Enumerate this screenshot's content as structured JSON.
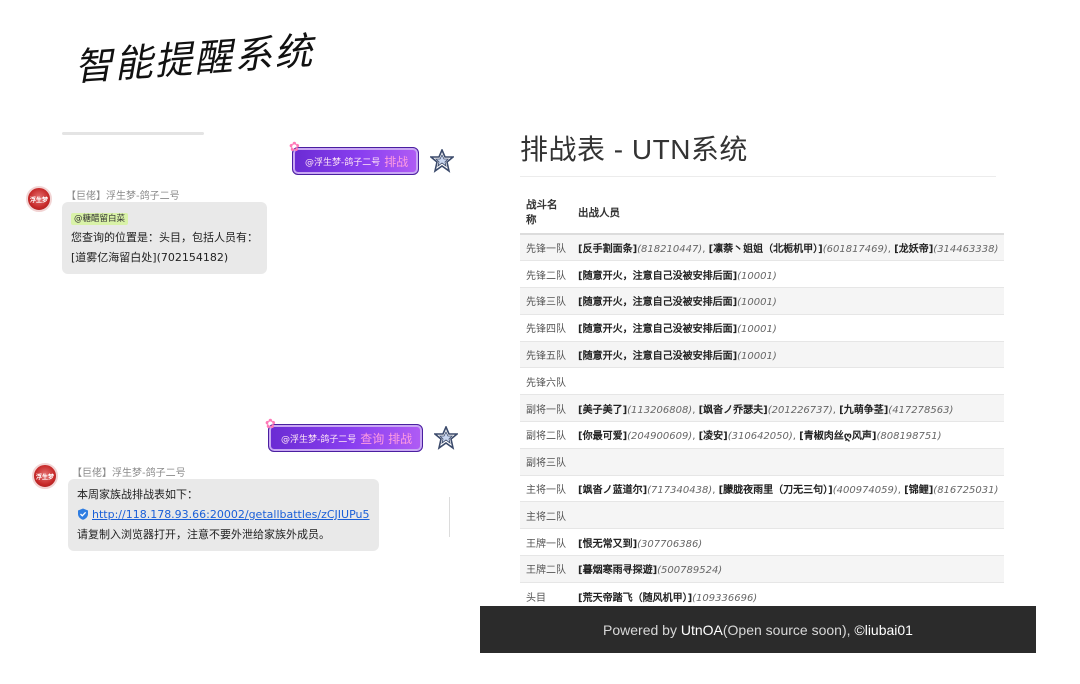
{
  "handwritten_title": "智能提醒系统",
  "chat": {
    "sent_1": {
      "mention": "@浮生梦-鸽子二号",
      "command": "排战"
    },
    "recv_1": {
      "sender": "【巨佬】浮生梦-鸽子二号",
      "at_tag": "@糖醋留白菜",
      "line1": "您查询的位置是：头目，包括人员有：",
      "line2": "[道雾亿海留白处](702154182)"
    },
    "sent_2": {
      "mention": "@浮生梦-鸽子二号",
      "command": "查询 排战"
    },
    "recv_2": {
      "sender": "【巨佬】浮生梦-鸽子二号",
      "line1": "本周家族战排战表如下：",
      "link": "http://118.178.93.66:20002/getallbattles/zCJIUPu5",
      "line3": "请复制入浏览器打开，注意不要外泄给家族外成员。"
    },
    "avatar_text": "浮生梦"
  },
  "panel": {
    "title": "排战表 - UTN系统",
    "columns": [
      "战斗名称",
      "出战人员"
    ],
    "rows": [
      {
        "team": "先锋一队",
        "members": [
          {
            "name": "[反手割面条]",
            "id": "(818210447)"
          },
          {
            "name": "[凛萘丶姐姐（北栀机甲）]",
            "id": "(601817469)"
          },
          {
            "name": "[龙妖帝]",
            "id": "(314463338)"
          }
        ]
      },
      {
        "team": "先锋二队",
        "members": [
          {
            "name": "[随意开火，注意自己没被安排后面]",
            "id": "(10001)"
          }
        ]
      },
      {
        "team": "先锋三队",
        "members": [
          {
            "name": "[随意开火，注意自己没被安排后面]",
            "id": "(10001)"
          }
        ]
      },
      {
        "team": "先锋四队",
        "members": [
          {
            "name": "[随意开火，注意自己没被安排后面]",
            "id": "(10001)"
          }
        ]
      },
      {
        "team": "先锋五队",
        "members": [
          {
            "name": "[随意开火，注意自己没被安排后面]",
            "id": "(10001)"
          }
        ]
      },
      {
        "team": "先锋六队",
        "members": []
      },
      {
        "team": "副将一队",
        "members": [
          {
            "name": "[美子美了]",
            "id": "(113206808)"
          },
          {
            "name": "[飒沓ノ乔瑟夫]",
            "id": "(201226737)"
          },
          {
            "name": "[九萌争茎]",
            "id": "(417278563)"
          }
        ]
      },
      {
        "team": "副将二队",
        "members": [
          {
            "name": "[你最可爱]",
            "id": "(204900609)"
          },
          {
            "name": "[凌安]",
            "id": "(310642050)"
          },
          {
            "name": "[青椒肉丝ღ风声]",
            "id": "(808198751)"
          }
        ]
      },
      {
        "team": "副将三队",
        "members": []
      },
      {
        "team": "主将一队",
        "members": [
          {
            "name": "[飒沓ノ蓝道尔]",
            "id": "(717340438)"
          },
          {
            "name": "[朦胧夜雨里（刀无三句）]",
            "id": "(400974059)"
          },
          {
            "name": "[锦鲤]",
            "id": "(816725031)"
          }
        ]
      },
      {
        "team": "主将二队",
        "members": []
      },
      {
        "team": "王牌一队",
        "members": [
          {
            "name": "[恨无常又到]",
            "id": "(307706386)"
          }
        ]
      },
      {
        "team": "王牌二队",
        "members": [
          {
            "name": "[暮烟寒雨寻探遊]",
            "id": "(500789524)"
          }
        ]
      },
      {
        "team": "头目",
        "members": [
          {
            "name": "[荒天帝踏飞（随风机甲）]",
            "id": "(109336696)"
          }
        ]
      }
    ]
  },
  "footer": {
    "prefix": "Powered by ",
    "brand": "UtnOA",
    "middle": " (Open source soon), ",
    "author": "©liubai01"
  },
  "colors": {
    "sent_bubble": "#7a35e6",
    "link": "#1a5fd8",
    "footer_bg": "#2b2b2b"
  }
}
